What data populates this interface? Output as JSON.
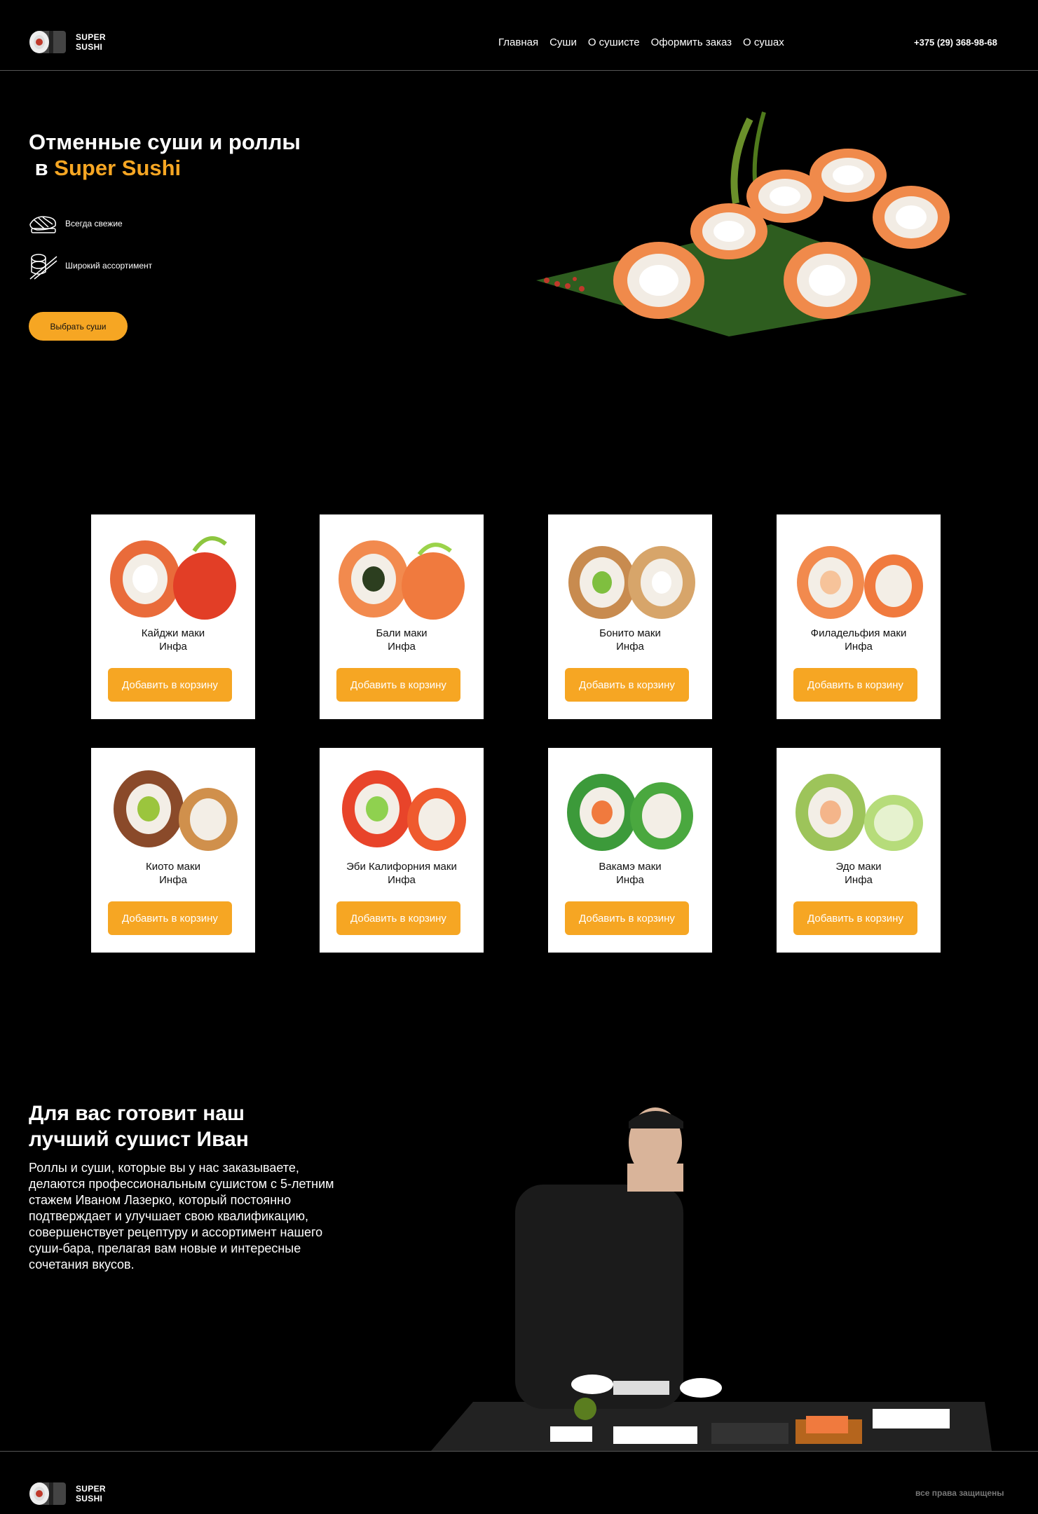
{
  "header": {
    "logo_line1": "SUPER",
    "logo_line2": "SUSHI",
    "nav": [
      "Главная",
      "Суши",
      "О сушисте",
      "Оформить заказ",
      "О сушах"
    ],
    "phone": "+375 (29) 368-98-68"
  },
  "hero": {
    "title_line1": "Отменные суши и роллы",
    "title_prefix": "в ",
    "title_accent": "Super Sushi",
    "features": [
      "Всегда свежие",
      "Широкий ассортимент"
    ],
    "cta": "Выбрать суши"
  },
  "products": [
    {
      "name": "Кайджи маки",
      "info": "Инфа",
      "button": "Добавить в корзину"
    },
    {
      "name": "Бали маки",
      "info": "Инфа",
      "button": "Добавить в корзину"
    },
    {
      "name": "Бонито маки",
      "info": "Инфа",
      "button": "Добавить в корзину"
    },
    {
      "name": "Филадельфия маки",
      "info": "Инфа",
      "button": "Добавить в корзину"
    },
    {
      "name": "Киото маки",
      "info": "Инфа",
      "button": "Добавить в корзину"
    },
    {
      "name": "Эби Калифорния маки",
      "info": "Инфа",
      "button": "Добавить в корзину"
    },
    {
      "name": "Вакамэ маки",
      "info": "Инфа",
      "button": "Добавить в корзину"
    },
    {
      "name": "Эдо маки",
      "info": "Инфа",
      "button": "Добавить в корзину"
    }
  ],
  "chef": {
    "title_line1": "Для вас готовит наш",
    "title_line2": "лучший сушист Иван",
    "text": "Роллы и суши, которые вы у нас заказываете, делаются профессиональным сушистом с 5-летним стажем Иваном Лазерко, который постоянно подтверждает и улучшает свою квалификацию, совершенствует рецептуру и ассортимент нашего суши-бара, прелагая вам новые и интересные сочетания вкусов."
  },
  "footer": {
    "logo_line1": "SUPER",
    "logo_line2": "SUSHI",
    "rights": "все права защищены"
  },
  "colors": {
    "accent": "#f6a623",
    "background": "#000000"
  }
}
